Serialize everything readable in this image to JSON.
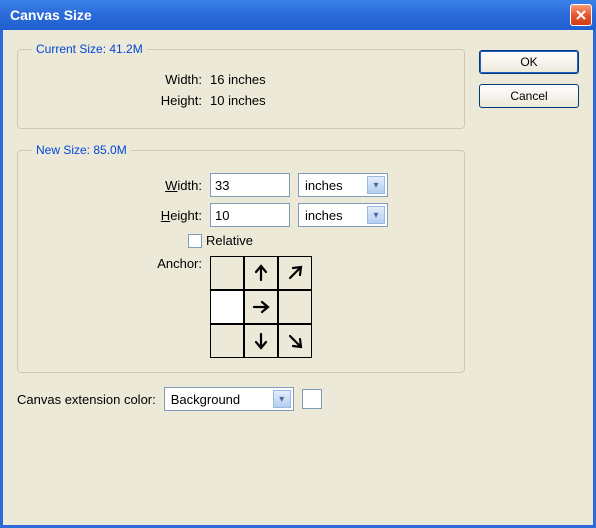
{
  "titlebar": {
    "title": "Canvas Size"
  },
  "currentSize": {
    "legend": "Current Size: 41.2M",
    "widthLabel": "Width:",
    "widthValue": "16 inches",
    "heightLabel": "Height:",
    "heightValue": "10 inches"
  },
  "newSize": {
    "legend": "New Size: 85.0M",
    "widthLabel": "Width:",
    "widthValue": "33",
    "widthUnit": "inches",
    "heightLabel": "Height:",
    "heightValue": "10",
    "heightUnit": "inches",
    "relativeLabel": "Relative",
    "anchorLabel": "Anchor:"
  },
  "extension": {
    "label": "Canvas extension color:",
    "value": "Background"
  },
  "buttons": {
    "ok": "OK",
    "cancel": "Cancel"
  }
}
